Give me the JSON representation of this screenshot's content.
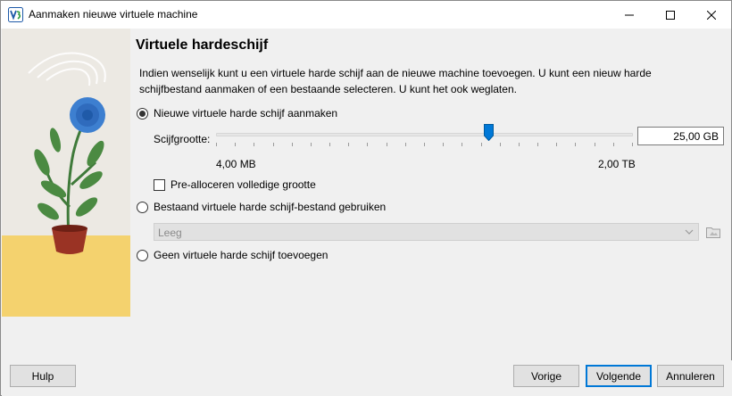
{
  "window": {
    "title": "Aanmaken nieuwe virtuele machine",
    "icon": "virtualbox-icon"
  },
  "page": {
    "heading": "Virtuele hardeschijf",
    "description": "Indien wenselijk kunt u een virtuele harde schijf aan de nieuwe machine toevoegen. U kunt een nieuw harde schijfbestand aanmaken of een bestaande selecteren. U kunt het ook weglaten."
  },
  "options": {
    "new_disk": {
      "label": "Nieuwe virtuele harde schijf aanmaken",
      "selected": true
    },
    "existing_disk": {
      "label": "Bestaand virtuele harde schijf-bestand gebruiken",
      "selected": false
    },
    "no_disk": {
      "label": "Geen virtuele harde schijf toevoegen",
      "selected": false
    }
  },
  "disk_size": {
    "label": "Scijfgrootte:",
    "value": "25,00 GB",
    "min_label": "4,00 MB",
    "max_label": "2,00 TB",
    "slider_fraction": 0.655
  },
  "preallocate": {
    "label": "Pre-alloceren volledige grootte",
    "checked": false
  },
  "existing_file": {
    "selected_value": "Leeg",
    "enabled": false
  },
  "buttons": {
    "help": "Hulp",
    "back": "Vorige",
    "next": "Volgende",
    "cancel": "Annuleren"
  },
  "colors": {
    "accent": "#0078d7",
    "illustration_floor": "#f4d26e",
    "flower": "#3d7fd0"
  }
}
